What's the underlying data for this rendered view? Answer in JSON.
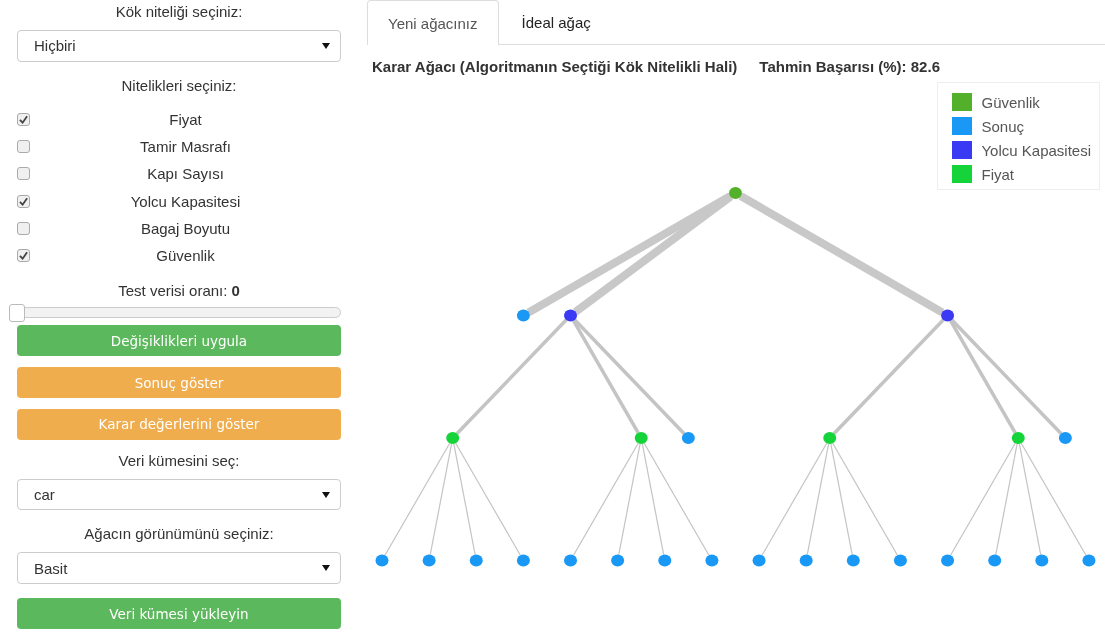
{
  "sidebar": {
    "root_label": "Kök niteliği seçiniz:",
    "root_select": {
      "value": "Hiçbiri"
    },
    "attributes_label": "Nitelikleri seçiniz:",
    "attributes": [
      {
        "label": "Fiyat",
        "checked": true
      },
      {
        "label": "Tamir Masrafı",
        "checked": false
      },
      {
        "label": "Kapı Sayısı",
        "checked": false
      },
      {
        "label": "Yolcu Kapasitesi",
        "checked": true
      },
      {
        "label": "Bagaj Boyutu",
        "checked": false
      },
      {
        "label": "Güvenlik",
        "checked": true
      }
    ],
    "test_label": "Test verisi oranı:",
    "test_value": "0",
    "test_slider": {
      "level": 0
    },
    "buttons": [
      {
        "label": "Değişiklikleri uygula",
        "kind": "success"
      },
      {
        "label": "Sonuç göster",
        "kind": "warning"
      },
      {
        "label": "Karar değerlerini göster",
        "kind": "warning"
      }
    ],
    "dataset_label": "Veri kümesini seç:",
    "dataset_select": {
      "value": "car"
    },
    "view_label": "Ağacın görünümünü seçiniz:",
    "view_select": {
      "value": "Basit"
    },
    "load_button": {
      "label": "Veri kümesi yükleyin",
      "kind": "success"
    }
  },
  "tabs": [
    {
      "label": "Yeni ağacınız",
      "selected": true
    },
    {
      "label": "İdeal ağaç",
      "selected": false
    }
  ],
  "tree_title": "Karar Ağacı (Algoritmanın Seçtiği Kök Nitelikli Hali)",
  "accuracy": "Tahmin Başarısı (%): 82.6",
  "legend": [
    {
      "label": "Güvenlik",
      "color": "#52b02b"
    },
    {
      "label": "Sonuç",
      "color": "#1a98f5"
    },
    {
      "label": "Yolcu Kapasitesi",
      "color": "#3a3af5"
    },
    {
      "label": "Fiyat",
      "color": "#14d43a"
    }
  ],
  "tree": {
    "color": "#52b02b",
    "children": [
      {
        "color": "#1a98f5"
      },
      {
        "color": "#3a3af5",
        "children": [
          {
            "color": "#14d43a",
            "children": [
              {
                "color": "#1a98f5"
              },
              {
                "color": "#1a98f5"
              },
              {
                "color": "#1a98f5"
              },
              {
                "color": "#1a98f5"
              }
            ]
          },
          {
            "color": "#14d43a",
            "children": [
              {
                "color": "#1a98f5"
              },
              {
                "color": "#1a98f5"
              },
              {
                "color": "#1a98f5"
              },
              {
                "color": "#1a98f5"
              }
            ]
          },
          {
            "color": "#1a98f5"
          }
        ]
      },
      {
        "color": "#3a3af5",
        "children": [
          {
            "color": "#14d43a",
            "children": [
              {
                "color": "#1a98f5"
              },
              {
                "color": "#1a98f5"
              },
              {
                "color": "#1a98f5"
              },
              {
                "color": "#1a98f5"
              }
            ]
          },
          {
            "color": "#14d43a",
            "children": [
              {
                "color": "#1a98f5"
              },
              {
                "color": "#1a98f5"
              },
              {
                "color": "#1a98f5"
              },
              {
                "color": "#1a98f5"
              }
            ]
          },
          {
            "color": "#1a98f5"
          }
        ]
      }
    ]
  }
}
